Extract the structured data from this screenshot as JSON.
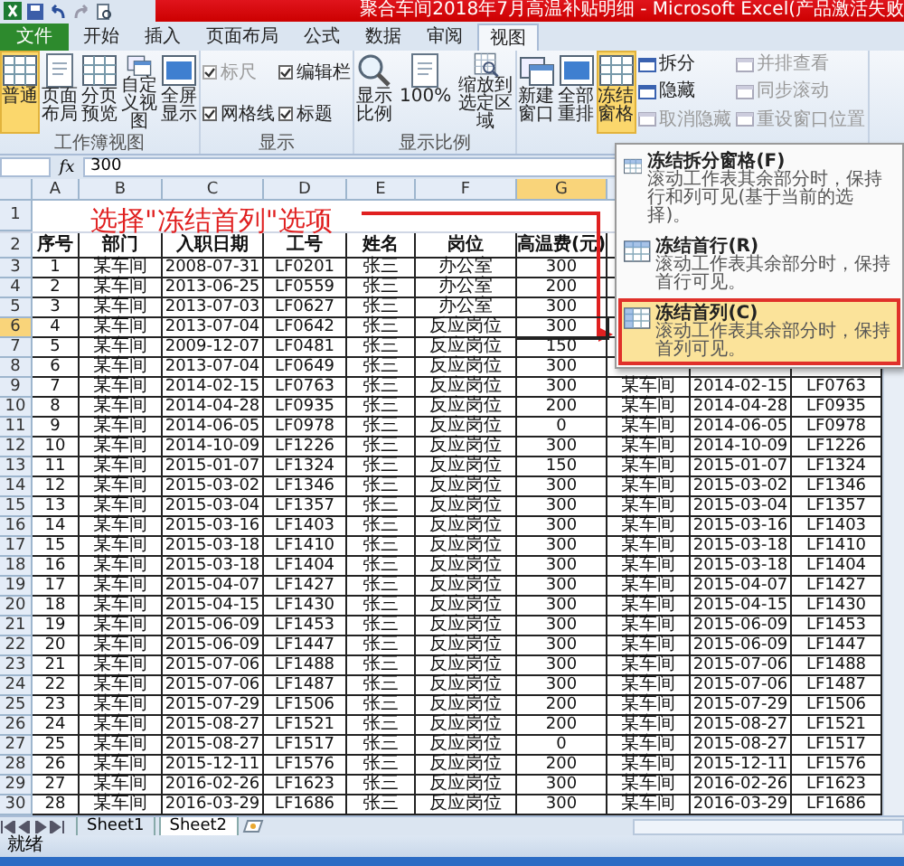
{
  "window": {
    "title": "聚合车间2018年7月高温补贴明细 - Microsoft Excel(产品激活失败"
  },
  "tabs": [
    {
      "label": "文件",
      "kind": "file",
      "selected": false
    },
    {
      "label": "开始",
      "kind": "tab",
      "selected": false
    },
    {
      "label": "插入",
      "kind": "tab",
      "selected": false
    },
    {
      "label": "页面布局",
      "kind": "tab",
      "selected": false
    },
    {
      "label": "公式",
      "kind": "tab",
      "selected": false
    },
    {
      "label": "数据",
      "kind": "tab",
      "selected": false
    },
    {
      "label": "审阅",
      "kind": "tab",
      "selected": false
    },
    {
      "label": "视图",
      "kind": "tab",
      "selected": true
    }
  ],
  "ribbon": [
    {
      "label": "工作簿视图",
      "items": [
        {
          "kind": "big",
          "label": "普通",
          "selected": true
        },
        {
          "kind": "big",
          "label": "页面布局",
          "selected": false
        },
        {
          "kind": "big",
          "label": "分页预览",
          "selected": false
        },
        {
          "kind": "big",
          "label": "自定义视图",
          "selected": false
        },
        {
          "kind": "big",
          "label": "全屏显示",
          "selected": false
        }
      ]
    },
    {
      "label": "显示",
      "items": [
        {
          "kind": "checks",
          "checks": [
            {
              "label": "标尺",
              "checked": true,
              "disabled": true
            },
            {
              "label": "网格线",
              "checked": true,
              "disabled": false
            }
          ]
        },
        {
          "kind": "checks",
          "checks": [
            {
              "label": "编辑栏",
              "checked": true,
              "disabled": false
            },
            {
              "label": "标题",
              "checked": true,
              "disabled": false
            }
          ]
        }
      ]
    },
    {
      "label": "显示比例",
      "items": [
        {
          "kind": "big",
          "label": "显示比例",
          "selected": false
        },
        {
          "kind": "big",
          "label": "100%",
          "selected": false
        },
        {
          "kind": "big",
          "label": "缩放到选定区域",
          "selected": false
        }
      ]
    },
    {
      "items": [
        {
          "kind": "big",
          "label": "新建窗口",
          "selected": false
        },
        {
          "kind": "big",
          "label": "全部重排",
          "selected": false
        },
        {
          "kind": "big",
          "label": "冻结窗格",
          "selected": true
        },
        {
          "kind": "stack",
          "buttons": [
            {
              "label": "拆分",
              "disabled": false
            },
            {
              "label": "隐藏",
              "disabled": false
            },
            {
              "label": "取消隐藏",
              "disabled": true
            }
          ]
        },
        {
          "kind": "stack",
          "buttons": [
            {
              "label": "并排查看",
              "disabled": true
            },
            {
              "label": "同步滚动",
              "disabled": true
            },
            {
              "label": "重设窗口位置",
              "disabled": true
            }
          ]
        }
      ]
    }
  ],
  "formula_bar": {
    "function_label": "fx",
    "value": "300"
  },
  "columns": [
    {
      "letter": "A",
      "selected": false
    },
    {
      "letter": "B",
      "selected": false
    },
    {
      "letter": "C",
      "selected": false
    },
    {
      "letter": "D",
      "selected": false
    },
    {
      "letter": "E",
      "selected": false
    },
    {
      "letter": "F",
      "selected": false
    },
    {
      "letter": "G",
      "selected": true
    }
  ],
  "annotation": {
    "row": "1",
    "text": "选择\"冻结首列\"选项"
  },
  "header_row": {
    "row": "2",
    "cells": [
      "序号",
      "部门",
      "入职日期",
      "工号",
      "姓名",
      "岗位",
      "高温费(元)"
    ]
  },
  "rows": [
    {
      "row": "3",
      "selected": false,
      "cells": [
        "1",
        "某车间",
        "2008-07-31",
        "LF0201",
        "张三",
        "办公室",
        "300"
      ]
    },
    {
      "row": "4",
      "selected": false,
      "cells": [
        "2",
        "某车间",
        "2013-06-25",
        "LF0559",
        "张三",
        "办公室",
        "200"
      ]
    },
    {
      "row": "5",
      "selected": false,
      "cells": [
        "3",
        "某车间",
        "2013-07-03",
        "LF0627",
        "张三",
        "办公室",
        "300"
      ]
    },
    {
      "row": "6",
      "selected": true,
      "cells": [
        "4",
        "某车间",
        "2013-07-04",
        "LF0642",
        "张三",
        "反应岗位",
        "300"
      ]
    },
    {
      "row": "7",
      "selected": false,
      "cells": [
        "5",
        "某车间",
        "2009-12-07",
        "LF0481",
        "张三",
        "反应岗位",
        "150"
      ]
    },
    {
      "row": "8",
      "selected": false,
      "cells": [
        "6",
        "某车间",
        "2013-07-04",
        "LF0649",
        "张三",
        "反应岗位",
        "300"
      ]
    },
    {
      "row": "9",
      "selected": false,
      "cells": [
        "7",
        "某车间",
        "2014-02-15",
        "LF0763",
        "张三",
        "反应岗位",
        "300"
      ],
      "right": [
        "某车间",
        "2014-02-15",
        "LF0763"
      ]
    },
    {
      "row": "10",
      "selected": false,
      "cells": [
        "8",
        "某车间",
        "2014-04-28",
        "LF0935",
        "张三",
        "反应岗位",
        "200"
      ],
      "right": [
        "某车间",
        "2014-04-28",
        "LF0935"
      ]
    },
    {
      "row": "11",
      "selected": false,
      "cells": [
        "9",
        "某车间",
        "2014-06-05",
        "LF0978",
        "张三",
        "反应岗位",
        "0"
      ],
      "right": [
        "某车间",
        "2014-06-05",
        "LF0978"
      ]
    },
    {
      "row": "12",
      "selected": false,
      "cells": [
        "10",
        "某车间",
        "2014-10-09",
        "LF1226",
        "张三",
        "反应岗位",
        "300"
      ],
      "right": [
        "某车间",
        "2014-10-09",
        "LF1226"
      ]
    },
    {
      "row": "13",
      "selected": false,
      "cells": [
        "11",
        "某车间",
        "2015-01-07",
        "LF1324",
        "张三",
        "反应岗位",
        "150"
      ],
      "right": [
        "某车间",
        "2015-01-07",
        "LF1324"
      ]
    },
    {
      "row": "14",
      "selected": false,
      "cells": [
        "12",
        "某车间",
        "2015-03-02",
        "LF1346",
        "张三",
        "反应岗位",
        "300"
      ],
      "right": [
        "某车间",
        "2015-03-02",
        "LF1346"
      ]
    },
    {
      "row": "15",
      "selected": false,
      "cells": [
        "13",
        "某车间",
        "2015-03-04",
        "LF1357",
        "张三",
        "反应岗位",
        "300"
      ],
      "right": [
        "某车间",
        "2015-03-04",
        "LF1357"
      ]
    },
    {
      "row": "16",
      "selected": false,
      "cells": [
        "14",
        "某车间",
        "2015-03-16",
        "LF1403",
        "张三",
        "反应岗位",
        "300"
      ],
      "right": [
        "某车间",
        "2015-03-16",
        "LF1403"
      ]
    },
    {
      "row": "17",
      "selected": false,
      "cells": [
        "15",
        "某车间",
        "2015-03-18",
        "LF1410",
        "张三",
        "反应岗位",
        "300"
      ],
      "right": [
        "某车间",
        "2015-03-18",
        "LF1410"
      ]
    },
    {
      "row": "18",
      "selected": false,
      "cells": [
        "16",
        "某车间",
        "2015-03-18",
        "LF1404",
        "张三",
        "反应岗位",
        "300"
      ],
      "right": [
        "某车间",
        "2015-03-18",
        "LF1404"
      ]
    },
    {
      "row": "19",
      "selected": false,
      "cells": [
        "17",
        "某车间",
        "2015-04-07",
        "LF1427",
        "张三",
        "反应岗位",
        "300"
      ],
      "right": [
        "某车间",
        "2015-04-07",
        "LF1427"
      ]
    },
    {
      "row": "20",
      "selected": false,
      "cells": [
        "18",
        "某车间",
        "2015-04-15",
        "LF1430",
        "张三",
        "反应岗位",
        "300"
      ],
      "right": [
        "某车间",
        "2015-04-15",
        "LF1430"
      ]
    },
    {
      "row": "21",
      "selected": false,
      "cells": [
        "19",
        "某车间",
        "2015-06-09",
        "LF1453",
        "张三",
        "反应岗位",
        "300"
      ],
      "right": [
        "某车间",
        "2015-06-09",
        "LF1453"
      ]
    },
    {
      "row": "22",
      "selected": false,
      "cells": [
        "20",
        "某车间",
        "2015-06-09",
        "LF1447",
        "张三",
        "反应岗位",
        "300"
      ],
      "right": [
        "某车间",
        "2015-06-09",
        "LF1447"
      ]
    },
    {
      "row": "23",
      "selected": false,
      "cells": [
        "21",
        "某车间",
        "2015-07-06",
        "LF1488",
        "张三",
        "反应岗位",
        "300"
      ],
      "right": [
        "某车间",
        "2015-07-06",
        "LF1488"
      ]
    },
    {
      "row": "24",
      "selected": false,
      "cells": [
        "22",
        "某车间",
        "2015-07-06",
        "LF1487",
        "张三",
        "反应岗位",
        "300"
      ],
      "right": [
        "某车间",
        "2015-07-06",
        "LF1487"
      ]
    },
    {
      "row": "25",
      "selected": false,
      "cells": [
        "23",
        "某车间",
        "2015-07-29",
        "LF1506",
        "张三",
        "反应岗位",
        "200"
      ],
      "right": [
        "某车间",
        "2015-07-29",
        "LF1506"
      ]
    },
    {
      "row": "26",
      "selected": false,
      "cells": [
        "24",
        "某车间",
        "2015-08-27",
        "LF1521",
        "张三",
        "反应岗位",
        "200"
      ],
      "right": [
        "某车间",
        "2015-08-27",
        "LF1521"
      ]
    },
    {
      "row": "27",
      "selected": false,
      "cells": [
        "25",
        "某车间",
        "2015-08-27",
        "LF1517",
        "张三",
        "反应岗位",
        "0"
      ],
      "right": [
        "某车间",
        "2015-08-27",
        "LF1517"
      ]
    },
    {
      "row": "28",
      "selected": false,
      "cells": [
        "26",
        "某车间",
        "2015-12-11",
        "LF1576",
        "张三",
        "反应岗位",
        "200"
      ],
      "right": [
        "某车间",
        "2015-12-11",
        "LF1576"
      ]
    },
    {
      "row": "29",
      "selected": false,
      "cells": [
        "27",
        "某车间",
        "2016-02-26",
        "LF1623",
        "张三",
        "反应岗位",
        "300"
      ],
      "right": [
        "某车间",
        "2016-02-26",
        "LF1623"
      ]
    },
    {
      "row": "30",
      "selected": false,
      "cells": [
        "28",
        "某车间",
        "2016-03-29",
        "LF1686",
        "张三",
        "反应岗位",
        "300"
      ],
      "right": [
        "某车间",
        "2016-03-29",
        "LF1686"
      ]
    }
  ],
  "freeze_menu": [
    {
      "title": "冻结拆分窗格(F)",
      "description": "滚动工作表其余部分时，保持行和列可见(基于当前的选择)。",
      "highlighted": false
    },
    {
      "title": "冻结首行(R)",
      "description": "滚动工作表其余部分时，保持首行可见。",
      "highlighted": false
    },
    {
      "title": "冻结首列(C)",
      "description": "滚动工作表其余部分时，保持首列可见。",
      "highlighted": true
    }
  ],
  "sheets": [
    {
      "label": "Sheet1",
      "selected": false
    },
    {
      "label": "Sheet2",
      "selected": true
    }
  ],
  "status_bar": {
    "text": "就绪"
  }
}
